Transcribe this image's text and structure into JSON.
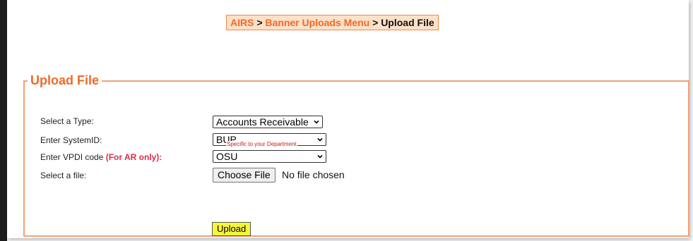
{
  "breadcrumb": {
    "items": [
      "AIRS",
      "Banner Uploads Menu",
      "Upload File"
    ],
    "separator": ">"
  },
  "form": {
    "legend": "Upload File",
    "type_label": "Select a Type:",
    "type_value": "Accounts Receivable",
    "system_label": "Enter SystemID:",
    "system_value": "BUP",
    "system_hint": "Specific to your Department",
    "vpdi_label": "Enter VPDI code",
    "vpdi_note": "(For AR only):",
    "vpdi_value": "OSU",
    "file_label": "Select a file:",
    "file_button": "Choose File",
    "file_status": "No file chosen",
    "upload_button": "Upload"
  },
  "colors": {
    "accent": "#ee6a2a",
    "breadcrumb_bg": "#fde0c7",
    "border": "#f2a077",
    "note": "#e2294b",
    "upload_bg": "#f5f53a"
  }
}
